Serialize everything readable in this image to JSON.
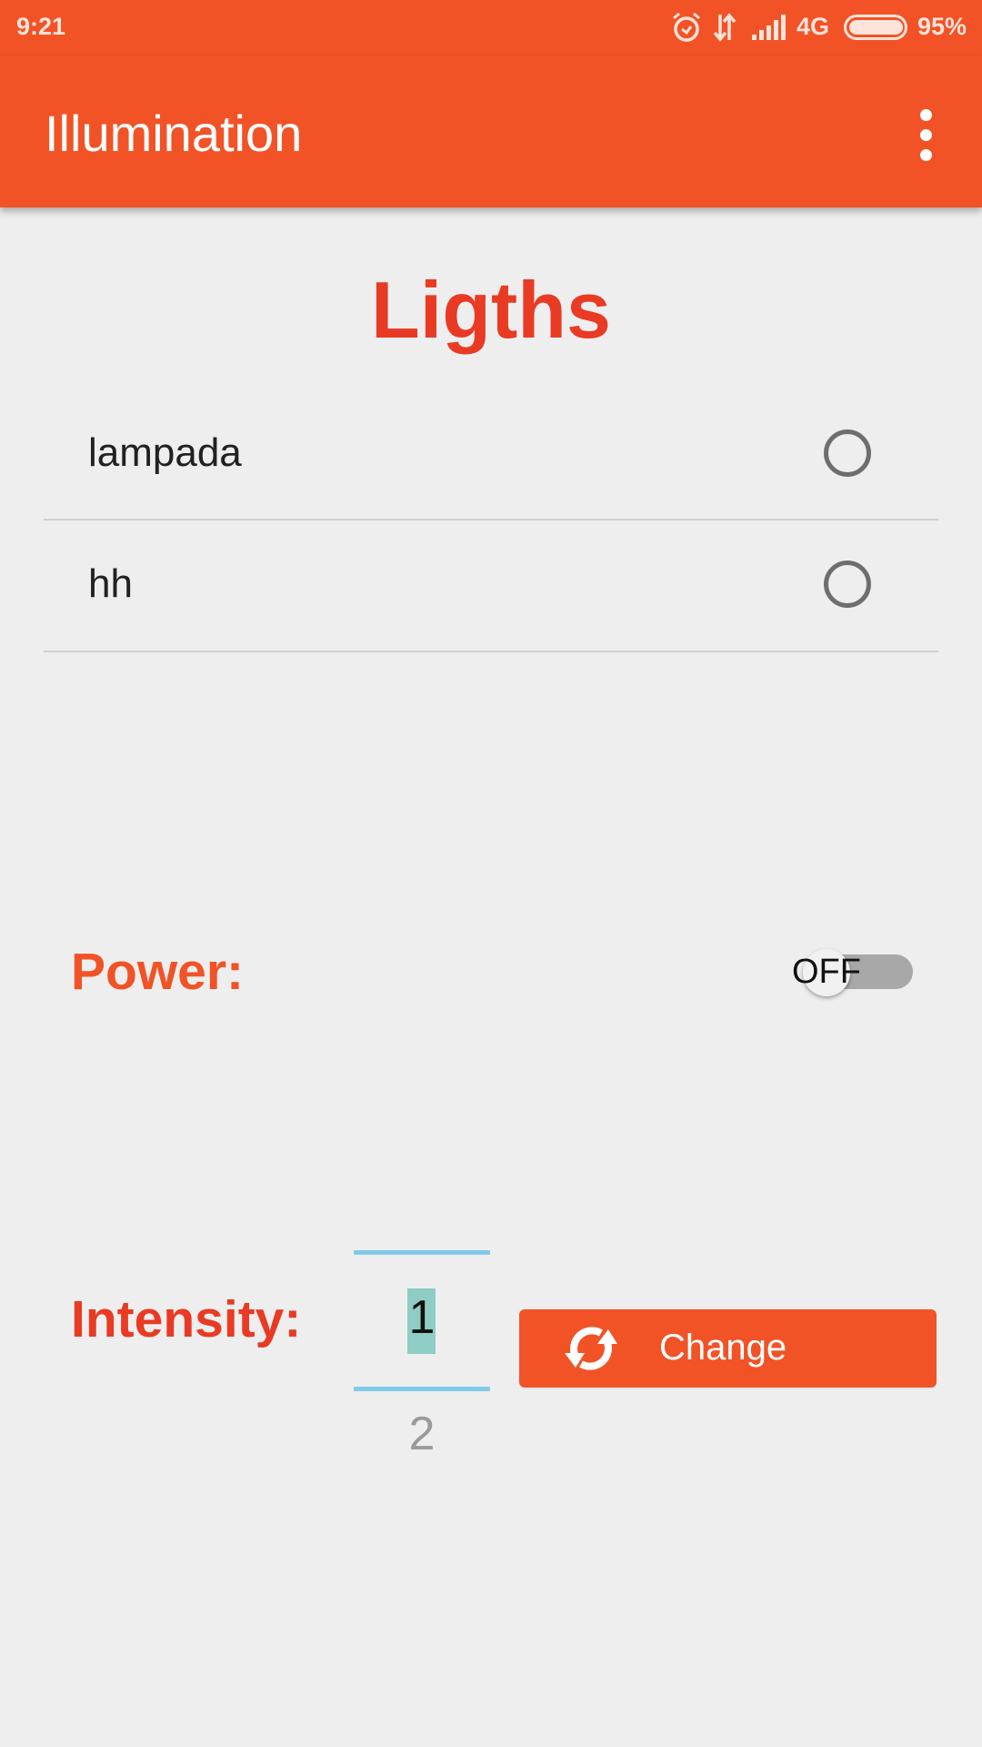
{
  "status_bar": {
    "time": "9:21",
    "network": "4G",
    "battery": "95%",
    "battery_level": 95,
    "icons": [
      "alarm-icon",
      "data-transfer-icon",
      "signal-icon",
      "battery-icon"
    ]
  },
  "toolbar": {
    "title": "Illumination",
    "menu_icon": "more-vert-icon"
  },
  "heading": "Ligths",
  "lights": [
    {
      "name": "lampada",
      "selected": false
    },
    {
      "name": "hh",
      "selected": false
    }
  ],
  "power": {
    "label": "Power:",
    "switch_text": "OFF",
    "on": false
  },
  "intensity": {
    "label": "Intensity:",
    "current": "1",
    "next": "2"
  },
  "change_button": {
    "label": "Change",
    "icon": "refresh-icon"
  },
  "colors": {
    "primary": "#f15326",
    "heading": "#e93a24",
    "picker_divider": "#7fcbe8",
    "selection": "#8fcdc4"
  }
}
